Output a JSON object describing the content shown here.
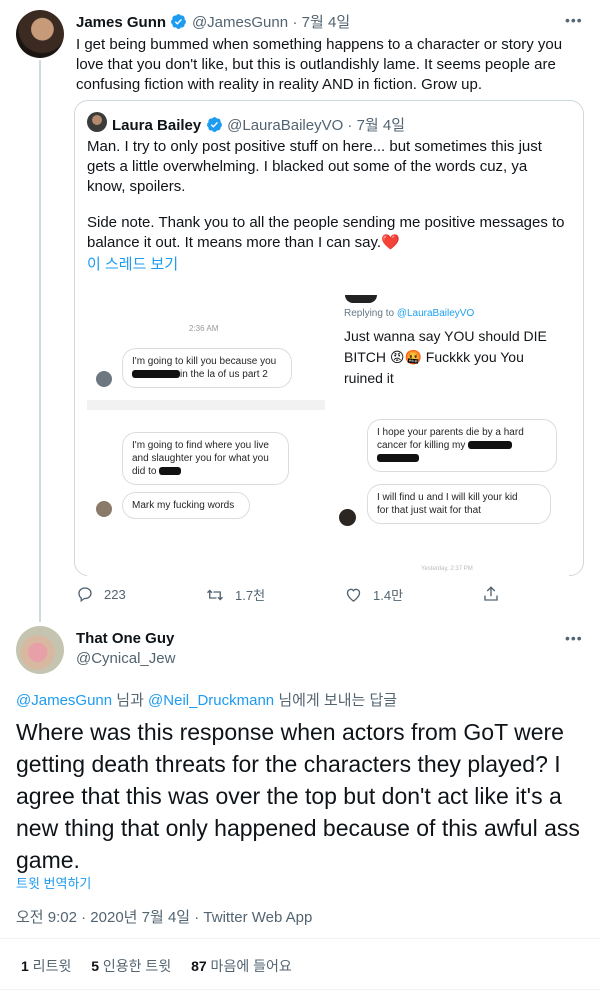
{
  "top_tweet": {
    "name": "James Gunn",
    "handle": "@JamesGunn",
    "date": "· 7월 4일",
    "text": "I get being bummed when something happens to a character or story you love that you don't like, but this is outlandishly lame. It seems people are confusing fiction with reality in reality AND in fiction. Grow up.",
    "more": "•••"
  },
  "quote": {
    "name": "Laura Bailey",
    "handle": "@LauraBaileyVO · 7월 4일",
    "text1": "Man. I try to only post positive stuff on here... but sometimes this just gets a little overwhelming. I blacked out some of the words cuz, ya know, spoilers.",
    "text2": "Side note. Thank you to all the people sending me positive messages to balance it out. It means more than I can say.❤️",
    "thread_link": "이 스레드 보기"
  },
  "screenshot": {
    "time_left": "2:36 AM",
    "msg1_a": "I'm going to kill you because you",
    "msg1_b": "in the la of us part 2",
    "msg2_a": "I'm going to find where you live",
    "msg2_b": "and slaughter you for what you",
    "msg2_c": "did to",
    "msg3": "Mark my fucking words",
    "reply_to_prefix": "Replying to ",
    "reply_to_handle": "@LauraBaileyVO",
    "reply_line1": "Just wanna say YOU should DIE",
    "reply_line2": "BITCH 😡🤬 Fuckkk you You",
    "reply_line3": "ruined it",
    "msg4_a": "I hope your parents die by a hard",
    "msg4_b": "cancer for killing my",
    "msg5_a": "I will find u and I will kill your kid",
    "msg5_b": "for that just wait for that",
    "time_right": "Yesterday, 2:37 PM"
  },
  "actions": {
    "replies": "223",
    "retweets": "1.7천",
    "likes": "1.4만"
  },
  "main_tweet": {
    "name": "That One Guy",
    "handle": "@Cynical_Jew",
    "more": "•••",
    "reply_user1": "@JamesGunn",
    "reply_mid": " 님과 ",
    "reply_user2": "@Neil_Druckmann",
    "reply_suffix": " 님에게 보내는 답글",
    "text": "Where was this response when actors from GoT were getting death threats for the characters they played? I agree that this was over the top but don't act like it's a new thing that only happened because of this awful ass game.",
    "translate": "트윗 번역하기",
    "meta": "오전 9:02 · 2020년 7월 4일 · Twitter Web App",
    "retweet_count": "1",
    "retweet_label": " 리트윗",
    "quote_count": "5",
    "quote_label": " 인용한 트윗",
    "like_count": "87",
    "like_label": " 마음에 들어요"
  }
}
